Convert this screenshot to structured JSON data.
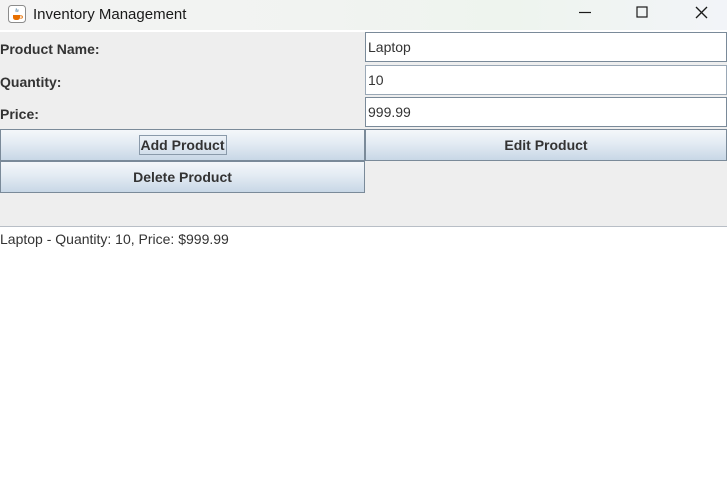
{
  "window": {
    "title": "Inventory Management",
    "app_icon": "java-cup-icon",
    "controls": [
      "minimize-icon",
      "maximize-icon",
      "close-icon"
    ]
  },
  "form": {
    "name_label": "Product Name:",
    "name_value": "Laptop",
    "quantity_label": "Quantity:",
    "quantity_value": "10",
    "price_label": "Price:",
    "price_value": "999.99"
  },
  "buttons": {
    "add": "Add Product",
    "edit": "Edit Product",
    "delete": "Delete Product"
  },
  "inventory_list": {
    "items": [
      "Laptop - Quantity: 10, Price: $999.99"
    ]
  },
  "colors": {
    "panel_background": "#eeeeee",
    "text": "#333333",
    "button_gradient_top": "#f4f7fa",
    "button_gradient_bottom": "#c8d7e6",
    "border": "#7a8a99"
  }
}
